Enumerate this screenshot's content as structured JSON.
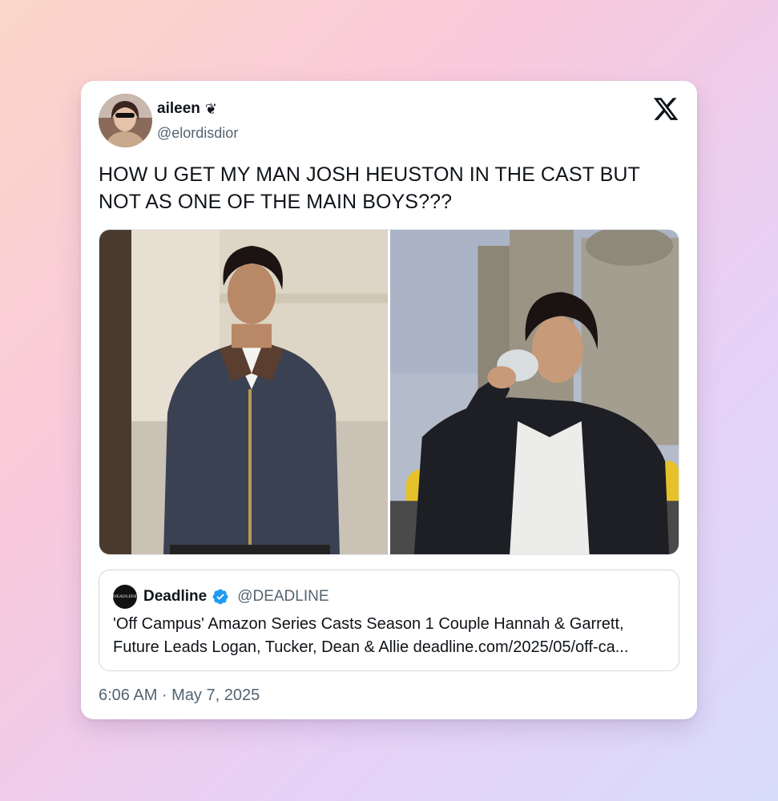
{
  "tweet": {
    "display_name": "aileen",
    "name_emoji": "❦",
    "handle": "@elordisdior",
    "text": "HOW U GET MY MAN JOSH HEUSTON IN THE CAST BUT NOT AS ONE OF THE MAIN BOYS???",
    "timestamp": "6:06 AM · May 7, 2025"
  },
  "media": [
    {
      "description_icon": "photo-man-denim-jacket"
    },
    {
      "description_icon": "photo-man-drinking-rooftop"
    }
  ],
  "quote": {
    "logo_text": "DEADLINE",
    "name": "Deadline",
    "handle": "@DEADLINE",
    "verified": true,
    "text": "'Off Campus' Amazon Series Casts Season 1 Couple Hannah & Garrett, Future Leads Logan, Tucker, Dean & Allie deadline.com/2025/05/off-ca..."
  },
  "colors": {
    "text_primary": "#0f1419",
    "text_secondary": "#536471",
    "verified_blue": "#1d9bf0"
  }
}
